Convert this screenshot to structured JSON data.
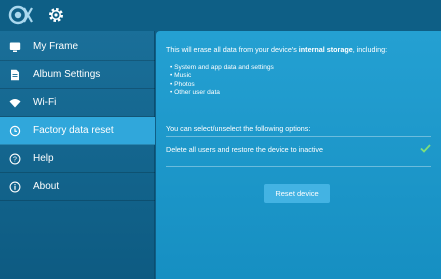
{
  "sidebar": {
    "items": [
      {
        "label": "My Frame",
        "icon": "monitor-icon"
      },
      {
        "label": "Album Settings",
        "icon": "document-icon"
      },
      {
        "label": "Wi-Fi",
        "icon": "wifi-icon"
      },
      {
        "label": "Factory data reset",
        "icon": "reset-icon",
        "active": true
      },
      {
        "label": "Help",
        "icon": "help-icon"
      },
      {
        "label": "About",
        "icon": "info-icon"
      }
    ]
  },
  "main": {
    "erase_prefix": "This will erase all data from your device's ",
    "erase_bold": "internal storage",
    "erase_suffix": ", including:",
    "bullets": [
      "• System and app data and settings",
      "• Music",
      "• Photos",
      "• Other user data"
    ],
    "options_label": "You can select/unselect the following options:",
    "option_delete_users": "Delete all users and restore the device to inactive",
    "option_checked": true,
    "reset_button": "Reset device"
  },
  "colors": {
    "accent": "#30a7db",
    "panel": "#1d98cc",
    "check": "#7ee07a"
  }
}
